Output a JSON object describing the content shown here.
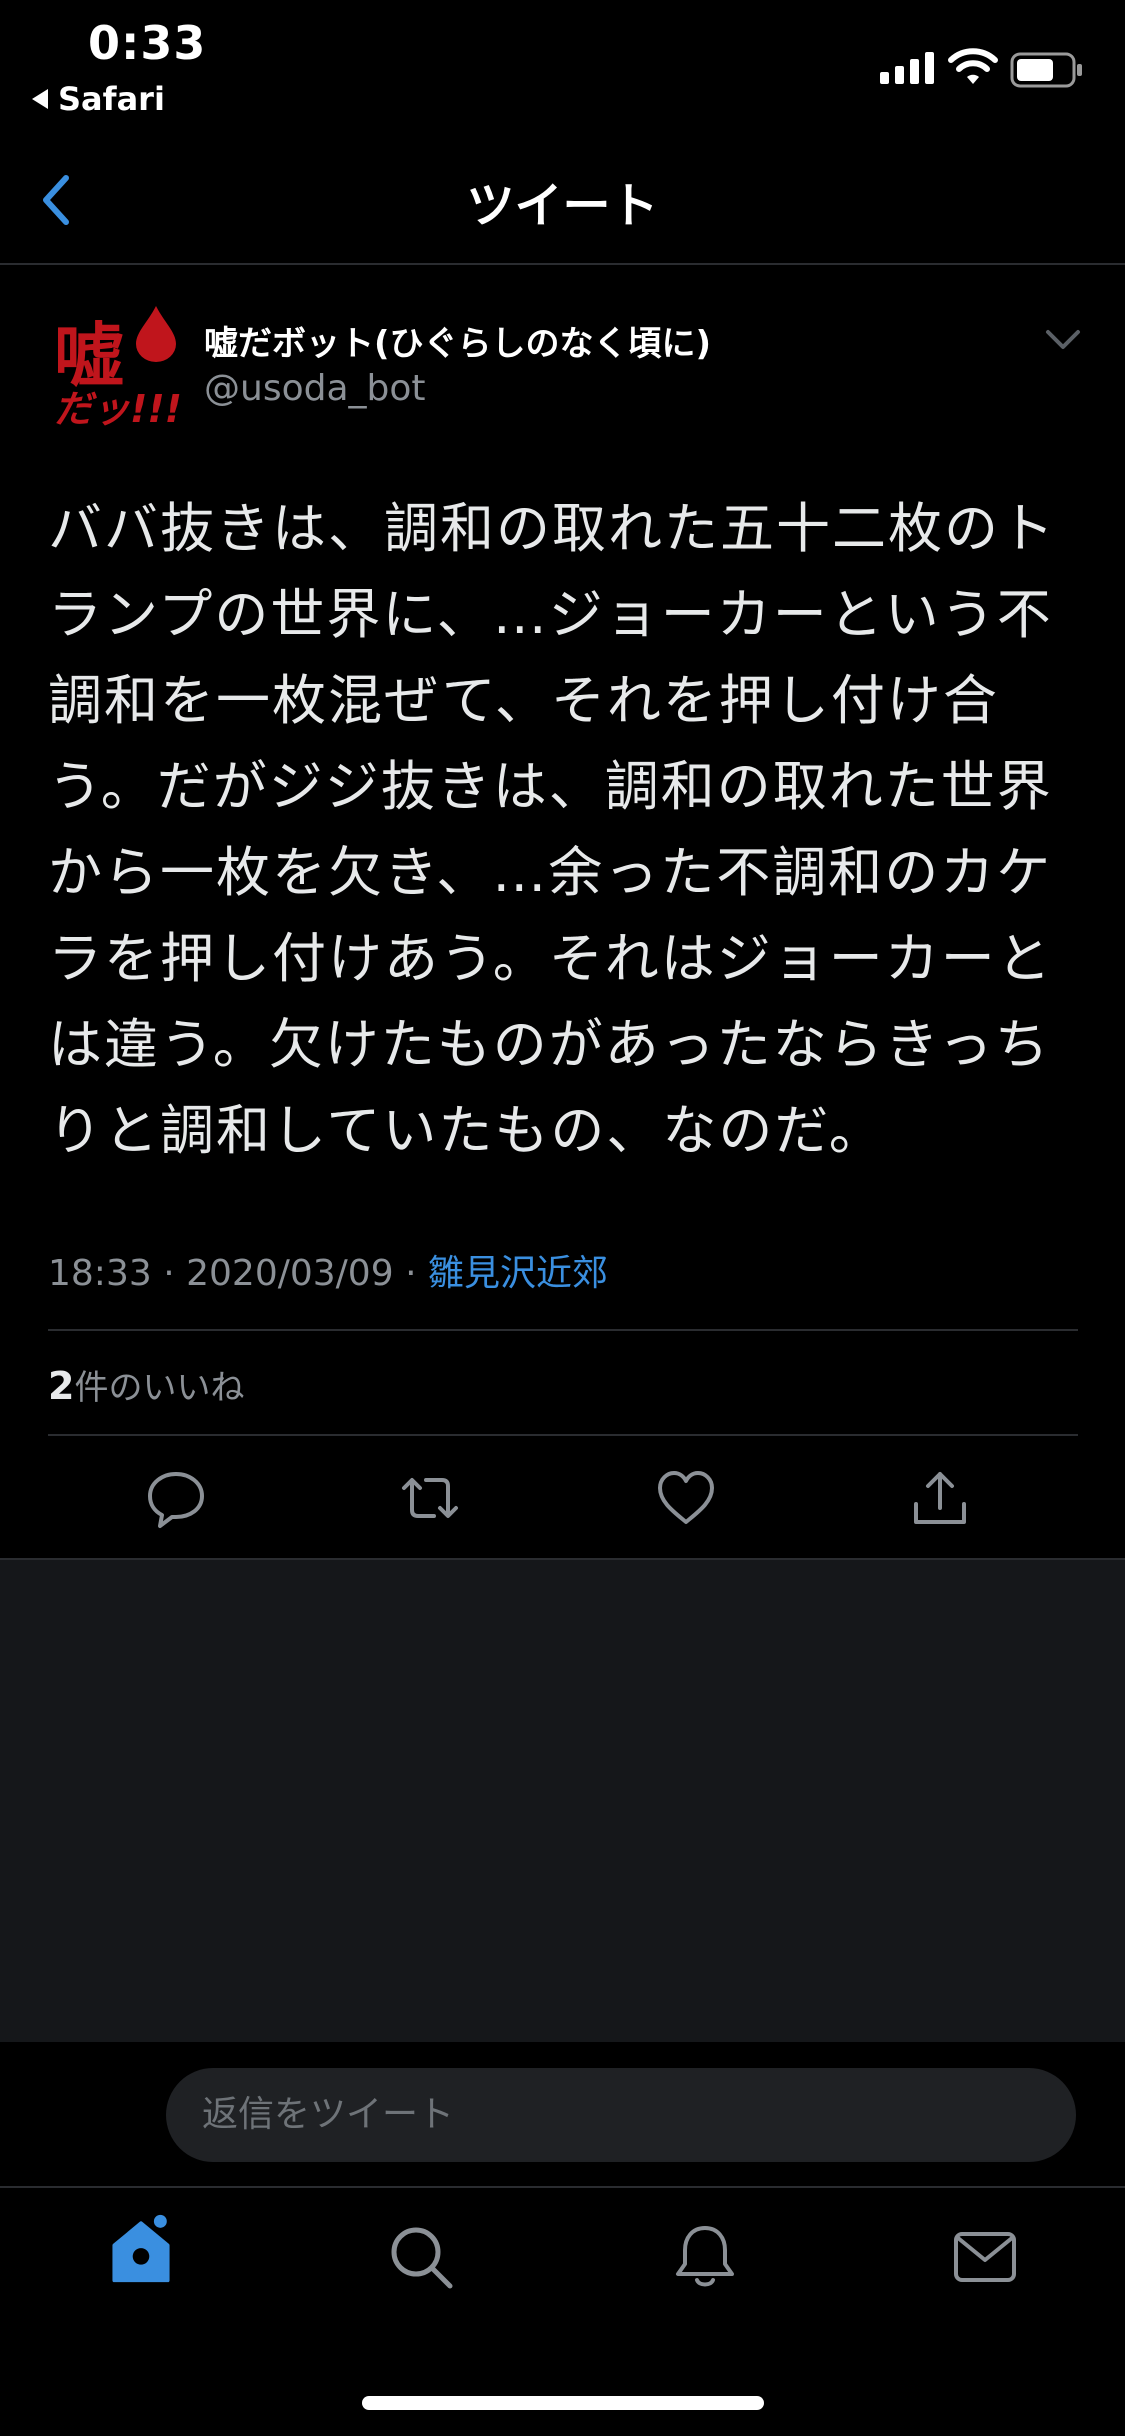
{
  "status_bar": {
    "time": "0:33",
    "back_app": "Safari"
  },
  "nav": {
    "title": "ツイート"
  },
  "tweet": {
    "avatar_text_top": "嘘",
    "avatar_text_bottom": "だッ!!!",
    "display_name": "嘘だボット(ひぐらしのなく頃に)",
    "handle": "@usoda_bot",
    "text": "ババ抜きは、調和の取れた五十二枚のトランプの世界に、…ジョーカーという不調和を一枚混ぜて、それを押し付け合う。だがジジ抜きは、調和の取れた世界から一枚を欠き、…余った不調和のカケラを押し付けあう。それはジョーカーとは違う。欠けたものがあったならきっちりと調和していたもの、なのだ。",
    "time": "18:33",
    "date": "2020/03/09",
    "separator": "·",
    "place": "雛見沢近郊",
    "likes_count": "2",
    "likes_label": "件のいいね"
  },
  "reply": {
    "placeholder": "返信をツイート"
  },
  "colors": {
    "accent": "#3a8fe0",
    "background": "#000000",
    "muted": "#8b9096",
    "avatar_red": "#c0151c"
  },
  "icons": {
    "actions": [
      "reply-icon",
      "retweet-icon",
      "like-icon",
      "share-icon"
    ],
    "tabs": [
      "home-icon",
      "search-icon",
      "notifications-icon",
      "messages-icon"
    ]
  }
}
